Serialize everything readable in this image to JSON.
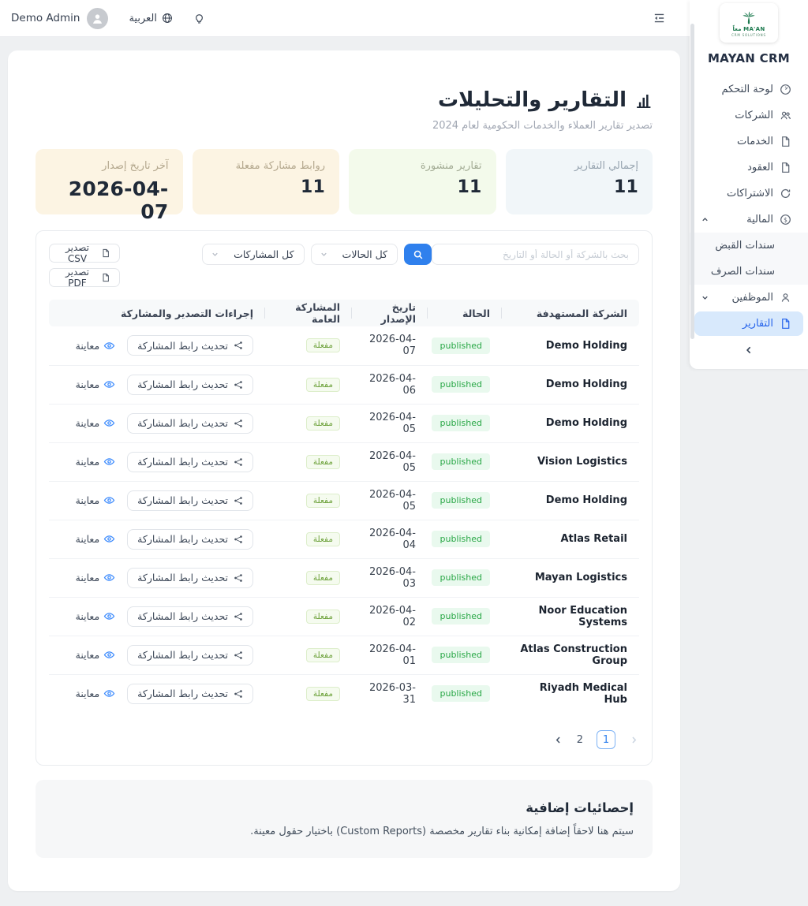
{
  "topbar": {
    "user_name": "Demo Admin",
    "language_label": "العربية"
  },
  "sidebar": {
    "logo_name": "MA'AN معاً",
    "logo_subtitle": "CRM SOLUTIONS",
    "app_name": "MAYAN CRM",
    "items": [
      {
        "label": "لوحة التحكم",
        "icon": "gauge"
      },
      {
        "label": "الشركات",
        "icon": "users"
      },
      {
        "label": "الخدمات",
        "icon": "file"
      },
      {
        "label": "العقود",
        "icon": "file"
      },
      {
        "label": "الاشتراكات",
        "icon": "sync"
      },
      {
        "label": "المالية",
        "icon": "dollar",
        "chevron": "up"
      },
      {
        "label": "سندات القبض",
        "sub": true
      },
      {
        "label": "سندات الصرف",
        "sub": true
      },
      {
        "label": "الموظفين",
        "icon": "user",
        "chevron": "down"
      },
      {
        "label": "التقارير",
        "icon": "file",
        "active": true
      }
    ]
  },
  "page": {
    "title": "التقارير والتحليلات",
    "subtitle": "تصدير تقارير العملاء والخدمات الحكومية لعام 2024",
    "stats": [
      {
        "label": "إجمالي التقارير",
        "value": "11",
        "bg": "#f1f6f9",
        "label_color": "#97a4b0"
      },
      {
        "label": "تقارير منشورة",
        "value": "11",
        "bg": "#f3faeb",
        "label_color": "#a2ab94"
      },
      {
        "label": "روابط مشاركة مفعلة",
        "value": "11",
        "bg": "#fcf4e3",
        "label_color": "#b3a78d"
      },
      {
        "label": "آخر تاريخ إصدار",
        "value": "2026-04-07",
        "bg": "#fcf4e3",
        "label_color": "#b3a78d",
        "wide": true
      }
    ],
    "filters": {
      "export_csv": "تصدير CSV",
      "export_pdf": "تصدير PDF",
      "share_filter": "كل المشاركات",
      "status_filter": "كل الحالات",
      "search_placeholder": "بحث بالشركة أو الحالة أو التاريخ"
    },
    "table": {
      "headers": [
        "الشركة المستهدفة",
        "الحالة",
        "تاريخ الإصدار",
        "المشاركة العامة",
        "إجراءات التصدير والمشاركة"
      ],
      "share_button_label": "تحديث رابط المشاركة",
      "preview_label": "معاينة",
      "rows": [
        {
          "company": "Demo Holding",
          "status": "published",
          "date": "2026-04-07",
          "sharing": "مفعلة"
        },
        {
          "company": "Demo Holding",
          "status": "published",
          "date": "2026-04-06",
          "sharing": "مفعلة"
        },
        {
          "company": "Demo Holding",
          "status": "published",
          "date": "2026-04-05",
          "sharing": "مفعلة"
        },
        {
          "company": "Vision Logistics",
          "status": "published",
          "date": "2026-04-05",
          "sharing": "مفعلة"
        },
        {
          "company": "Demo Holding",
          "status": "published",
          "date": "2026-04-05",
          "sharing": "مفعلة"
        },
        {
          "company": "Atlas Retail",
          "status": "published",
          "date": "2026-04-04",
          "sharing": "مفعلة"
        },
        {
          "company": "Mayan Logistics",
          "status": "published",
          "date": "2026-04-03",
          "sharing": "مفعلة"
        },
        {
          "company": "Noor Education Systems",
          "status": "published",
          "date": "2026-04-02",
          "sharing": "مفعلة"
        },
        {
          "company": "Atlas Construction Group",
          "status": "published",
          "date": "2026-04-01",
          "sharing": "مفعلة"
        },
        {
          "company": "Riyadh Medical Hub",
          "status": "published",
          "date": "2026-03-31",
          "sharing": "مفعلة"
        }
      ]
    },
    "pagination": {
      "pages": [
        "2",
        "1"
      ],
      "active": "1"
    },
    "extra": {
      "title": "إحصائيات إضافية",
      "text": "سيتم هنا لاحقاً إضافة إمكانية بناء تقارير مخصصة (Custom Reports) باختيار حقول معينة."
    }
  },
  "colors": {
    "accent_blue": "#2f80ed",
    "active_nav_bg": "#d8e9fc",
    "published_badge_bg": "#e9f9ee",
    "published_badge_text": "#28a745",
    "active_badge_bg": "#f5fbef",
    "active_badge_text": "#6ea23c",
    "logo_green": "#1d7a4f"
  }
}
